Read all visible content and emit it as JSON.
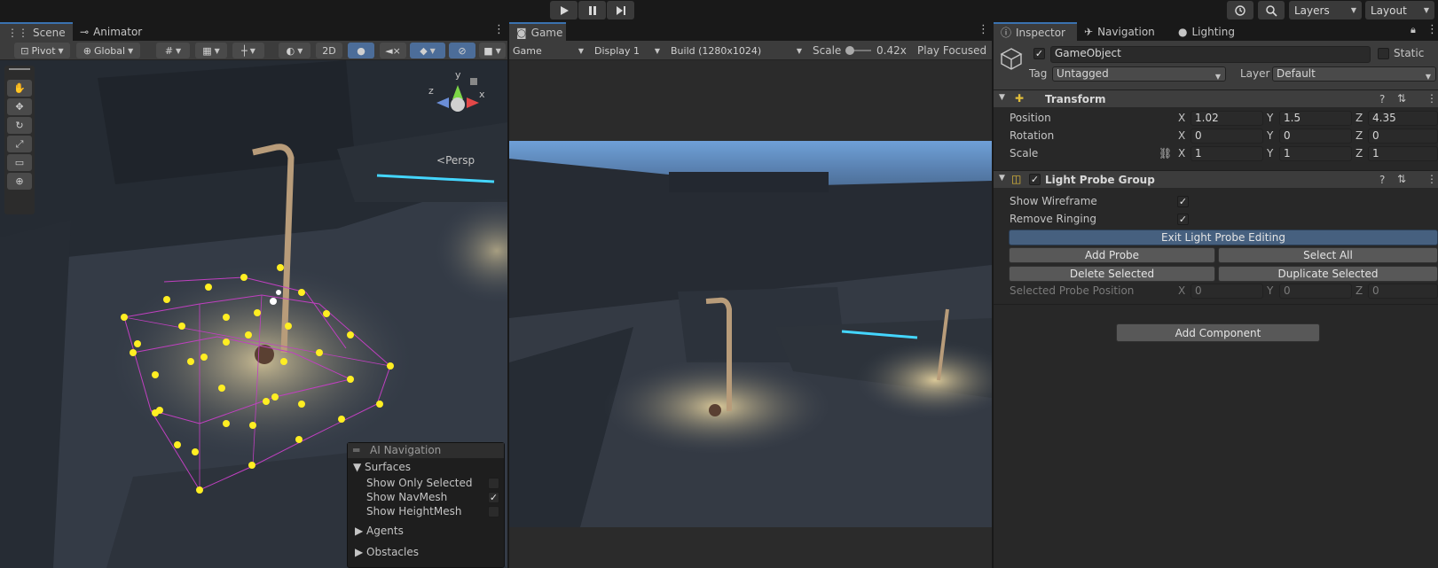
{
  "topbar": {
    "play_icon": "play-icon",
    "pause_icon": "pause-icon",
    "step_icon": "step-icon",
    "history_icon": "history-icon",
    "search_icon": "search-icon",
    "layers_label": "Layers",
    "layout_label": "Layout"
  },
  "scene": {
    "tabs": [
      {
        "label": "Scene",
        "icon": "grid-icon"
      },
      {
        "label": "Animator",
        "icon": "animator-icon"
      }
    ],
    "toolbar": {
      "pivot_label": "Pivot",
      "global_label": "Global",
      "mode_2d": "2D"
    },
    "tools": [
      "hand-tool",
      "move-tool",
      "rotate-tool",
      "scale-tool",
      "rect-tool",
      "transform-tool"
    ],
    "gizmo": {
      "y": "y",
      "x": "x",
      "z": "z",
      "projection": "Persp"
    },
    "ai_nav": {
      "title": "AI Navigation",
      "surfaces": "Surfaces",
      "options": [
        {
          "label": "Show Only Selected",
          "checked": false
        },
        {
          "label": "Show NavMesh",
          "checked": true
        },
        {
          "label": "Show HeightMesh",
          "checked": false
        }
      ],
      "agents": "Agents",
      "obstacles": "Obstacles"
    }
  },
  "game": {
    "tab": "Game",
    "toolbar": {
      "view": "Game",
      "display": "Display 1",
      "resolution": "Build (1280x1024)",
      "scale_label": "Scale",
      "scale_value": "0.42x",
      "scale_fraction": 0.08,
      "play_mode": "Play Focused"
    }
  },
  "inspector": {
    "tabs": [
      {
        "label": "Inspector",
        "icon": "info-icon"
      },
      {
        "label": "Navigation",
        "icon": "navigation-icon"
      },
      {
        "label": "Lighting",
        "icon": "lightbulb-icon"
      }
    ],
    "object_name": "GameObject",
    "static_label": "Static",
    "tag_label": "Tag",
    "tag_value": "Untagged",
    "layer_label": "Layer",
    "layer_value": "Default",
    "transform": {
      "title": "Transform",
      "rows": [
        {
          "label": "Position",
          "x": "1.02",
          "y": "1.5",
          "z": "4.35"
        },
        {
          "label": "Rotation",
          "x": "0",
          "y": "0",
          "z": "0"
        },
        {
          "label": "Scale",
          "x": "1",
          "y": "1",
          "z": "1"
        }
      ]
    },
    "light_probe_group": {
      "title": "Light Probe Group",
      "show_wireframe": "Show Wireframe",
      "remove_ringing": "Remove Ringing",
      "exit_editing": "Exit Light Probe Editing",
      "add_probe": "Add Probe",
      "select_all": "Select All",
      "delete_selected": "Delete Selected",
      "duplicate_selected": "Duplicate Selected",
      "selected_position": "Selected Probe Position",
      "sel_x": "0",
      "sel_y": "0",
      "sel_z": "0"
    },
    "add_component": "Add Component",
    "axis_x": "X",
    "axis_y": "Y",
    "axis_z": "Z"
  },
  "colors": {
    "accent": "#4c6d99",
    "background": "#282828",
    "probe": "#ffee22",
    "wire": "#c040c0"
  }
}
